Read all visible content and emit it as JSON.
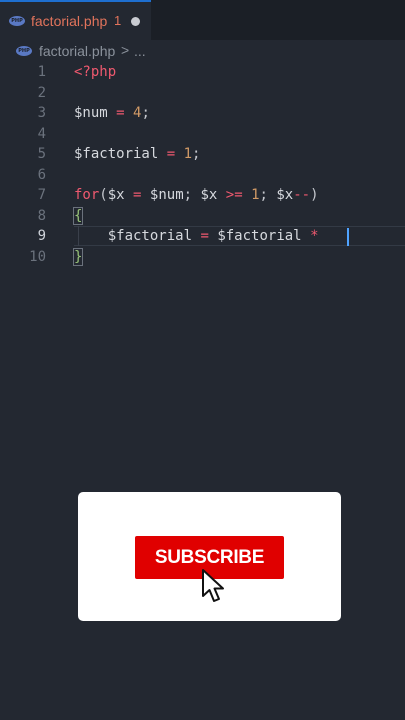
{
  "tab": {
    "file_icon": "PHP",
    "title": "factorial.php",
    "problem_count": "1",
    "modified_indicator": "unsaved-dot"
  },
  "breadcrumb": {
    "file_icon": "PHP",
    "file": "factorial.php",
    "separator": ">",
    "more": "..."
  },
  "editor": {
    "active_line": "9",
    "line_numbers": [
      "1",
      "2",
      "3",
      "4",
      "5",
      "6",
      "7",
      "8",
      "9",
      "10"
    ],
    "lines": [
      [
        {
          "t": "<?php",
          "c": "kw"
        }
      ],
      [],
      [
        {
          "t": "$num",
          "c": "var"
        },
        {
          "t": " ",
          "c": "var"
        },
        {
          "t": "=",
          "c": "op"
        },
        {
          "t": " ",
          "c": "var"
        },
        {
          "t": "4",
          "c": "num"
        },
        {
          "t": ";",
          "c": "punc"
        }
      ],
      [],
      [
        {
          "t": "$factorial",
          "c": "var"
        },
        {
          "t": " ",
          "c": "var"
        },
        {
          "t": "=",
          "c": "op"
        },
        {
          "t": " ",
          "c": "var"
        },
        {
          "t": "1",
          "c": "num"
        },
        {
          "t": ";",
          "c": "punc"
        }
      ],
      [],
      [
        {
          "t": "for",
          "c": "kw"
        },
        {
          "t": "(",
          "c": "punc"
        },
        {
          "t": "$x",
          "c": "var"
        },
        {
          "t": " ",
          "c": "var"
        },
        {
          "t": "=",
          "c": "op"
        },
        {
          "t": " ",
          "c": "var"
        },
        {
          "t": "$num",
          "c": "var"
        },
        {
          "t": "; ",
          "c": "punc"
        },
        {
          "t": "$x",
          "c": "var"
        },
        {
          "t": " ",
          "c": "var"
        },
        {
          "t": ">=",
          "c": "op"
        },
        {
          "t": " ",
          "c": "var"
        },
        {
          "t": "1",
          "c": "num"
        },
        {
          "t": "; ",
          "c": "punc"
        },
        {
          "t": "$x",
          "c": "var"
        },
        {
          "t": "--",
          "c": "op"
        },
        {
          "t": ")",
          "c": "punc"
        }
      ],
      [
        {
          "t": "{",
          "c": "brace"
        }
      ],
      [
        {
          "t": "    ",
          "c": "var"
        },
        {
          "t": "$factorial",
          "c": "var"
        },
        {
          "t": " ",
          "c": "var"
        },
        {
          "t": "=",
          "c": "op"
        },
        {
          "t": " ",
          "c": "var"
        },
        {
          "t": "$factorial",
          "c": "var"
        },
        {
          "t": " ",
          "c": "var"
        },
        {
          "t": "*",
          "c": "op"
        },
        {
          "t": " ",
          "c": "var"
        }
      ],
      [
        {
          "t": "}",
          "c": "brace"
        }
      ]
    ]
  },
  "overlay": {
    "subscribe_label": "SUBSCRIBE",
    "cursor_icon": "mouse-pointer-icon"
  },
  "colors": {
    "accent": "#1e6fd0",
    "subscribe_red": "#e00000",
    "keyword": "#ef596f",
    "number": "#d19a66"
  }
}
